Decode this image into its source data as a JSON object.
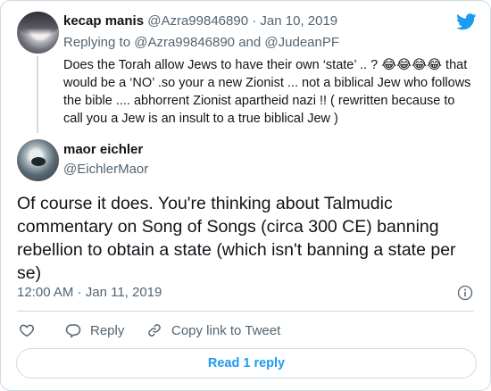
{
  "reply_tweet": {
    "author_name": "kecap manis",
    "handle": "@Azra99846890",
    "separator": "·",
    "date": "Jan 10, 2019",
    "replying_to_prefix": "Replying to",
    "replying_to_1": "@Azra99846890",
    "replying_to_and": "and",
    "replying_to_2": "@JudeanPF",
    "text": "Does the Torah allow Jews to have their own ‘state’ .. ? 😂😂😂😂 that would be a ‘NO’ .so your a new Zionist ... not a biblical Jew who follows the bible .... abhorrent Zionist apartheid nazi !! ( rewritten because to call you a Jew is an insult to a true biblical Jew )"
  },
  "main_tweet": {
    "author_name": "maor eichler",
    "handle": "@EichlerMaor",
    "text": "Of course it does. You're thinking about Talmudic commentary on Song of Songs (circa 300 CE) banning rebellion to obtain a state (which isn't banning a state per se)",
    "time": "12:00 AM",
    "separator": "·",
    "date": "Jan 11, 2019"
  },
  "actions": {
    "reply_label": "Reply",
    "copy_link_label": "Copy link to Tweet"
  },
  "read_replies_label": "Read 1 reply",
  "icons": {
    "brand": "twitter-bird-icon",
    "info": "info-icon",
    "like": "heart-icon",
    "reply": "reply-bubble-icon",
    "copy": "link-icon"
  },
  "colors": {
    "accent": "#1d9bf0",
    "muted": "#536471",
    "border": "#cfd9de"
  }
}
